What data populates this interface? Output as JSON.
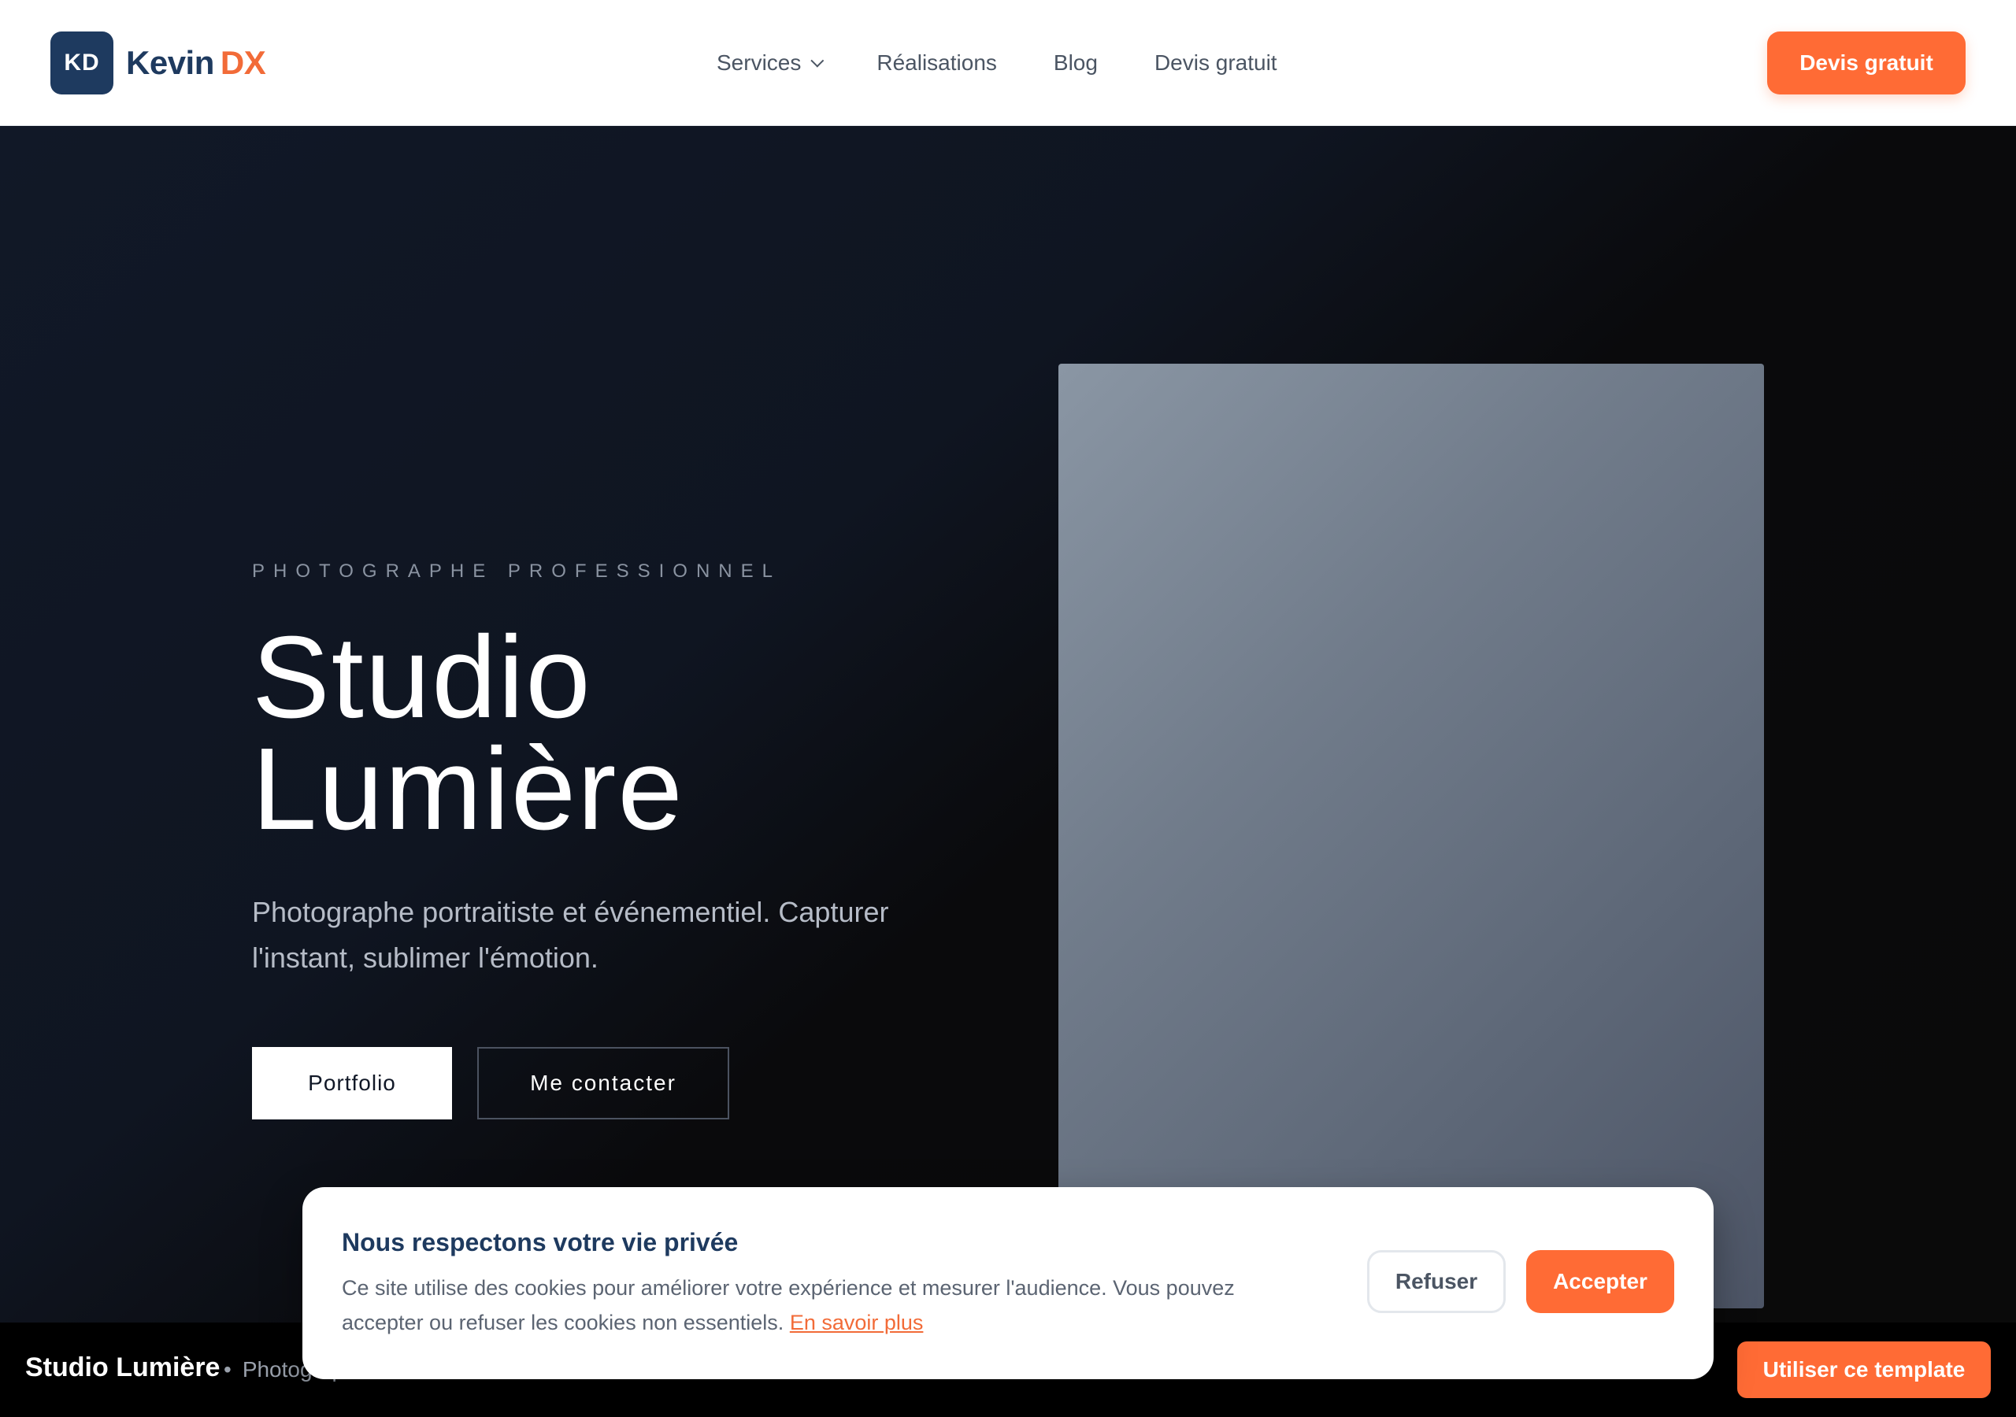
{
  "header": {
    "logo_badge": "KD",
    "logo_name": "Kevin",
    "logo_accent": "DX",
    "nav": [
      {
        "label": "Services"
      },
      {
        "label": "Réalisations"
      },
      {
        "label": "Blog"
      },
      {
        "label": "Devis gratuit"
      }
    ],
    "cta_label": "Devis gratuit"
  },
  "hero": {
    "eyebrow": "PHOTOGRAPHE PROFESSIONNEL",
    "title_line1": "Studio",
    "title_line2": "Lumière",
    "subtitle": "Photographe portraitiste et événementiel. Capturer l'instant, sublimer l'émotion.",
    "primary_button": "Portfolio",
    "secondary_button": "Me contacter"
  },
  "bottom_bar": {
    "title": "Studio Lumière",
    "meta": "Photographe",
    "template_button": "Utiliser ce template"
  },
  "cookie_banner": {
    "title": "Nous respectons votre vie privée",
    "text": "Ce site utilise des cookies pour améliorer votre expérience et mesurer l'audience. Vous pouvez accepter ou refuser les cookies non essentiels.",
    "link": "En savoir plus",
    "refuse_label": "Refuser",
    "accept_label": "Accepter"
  },
  "colors": {
    "brand_navy": "#1e3a5f",
    "accent_orange": "#ff6b35",
    "hero_dark": "#0a0a0a"
  }
}
